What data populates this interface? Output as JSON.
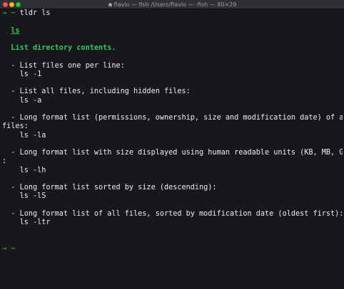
{
  "window": {
    "title": "flavio — fish /Users/flavio — -fish — 80×29"
  },
  "terminal": {
    "prompt_arrow": "→",
    "prompt_dir": "~",
    "command": "tldr ls",
    "page": {
      "heading": "ls",
      "description": "List directory contents.",
      "examples": [
        {
          "text": "- List files one per line:",
          "code": "ls -1"
        },
        {
          "text": "- List all files, including hidden files:",
          "code": "ls -a"
        },
        {
          "text": "- Long format list (permissions, ownership, size and modification date) of all",
          "text_cont": "files:",
          "code": "ls -la"
        },
        {
          "text": "- Long format list with size displayed using human readable units (KB, MB, GB)",
          "text_cont": ":",
          "code": "ls -lh"
        },
        {
          "text": "- Long format list sorted by size (descending):",
          "code": "ls -lS"
        },
        {
          "text": "- Long format list of all files, sorted by modification date (oldest first):",
          "code": "ls -ltr"
        }
      ]
    },
    "final_prompt_dir": "~"
  },
  "colors": {
    "background": "#17181c",
    "green": "#36c75f",
    "text": "#ecedee"
  }
}
